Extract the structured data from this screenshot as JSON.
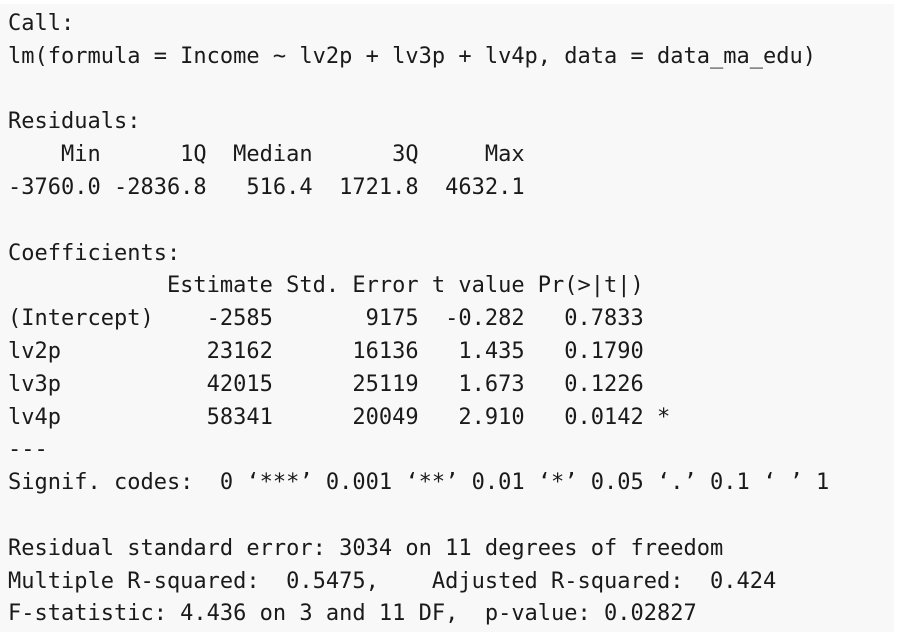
{
  "output": {
    "call_header": "Call:",
    "call_formula": "lm(formula = Income ~ lv2p + lv3p + lv4p, data = data_ma_edu)",
    "residuals_header": "Residuals:",
    "residuals_labels_row": "    Min      1Q  Median      3Q     Max ",
    "residuals_values_row": "-3760.0 -2836.8   516.4  1721.8  4632.1 ",
    "coefficients_header": "Coefficients:",
    "coef_header_row": "            Estimate Std. Error t value Pr(>|t|)  ",
    "coef_rows": [
      "(Intercept)    -2585       9175  -0.282   0.7833  ",
      "lv2p           23162      16136   1.435   0.1790  ",
      "lv3p           42015      25119   1.673   0.1226  ",
      "lv4p           58341      20049   2.910   0.0142 *"
    ],
    "separator": "---",
    "signif_codes": "Signif. codes:  0 ‘***’ 0.001 ‘**’ 0.01 ‘*’ 0.05 ‘.’ 0.1 ‘ ’ 1",
    "residual_std_error": "Residual standard error: 3034 on 11 degrees of freedom",
    "r_squared": "Multiple R-squared:  0.5475,\tAdjusted R-squared:  0.424 ",
    "f_statistic": "F-statistic: 4.436 on 3 and 11 DF,  p-value: 0.02827"
  }
}
